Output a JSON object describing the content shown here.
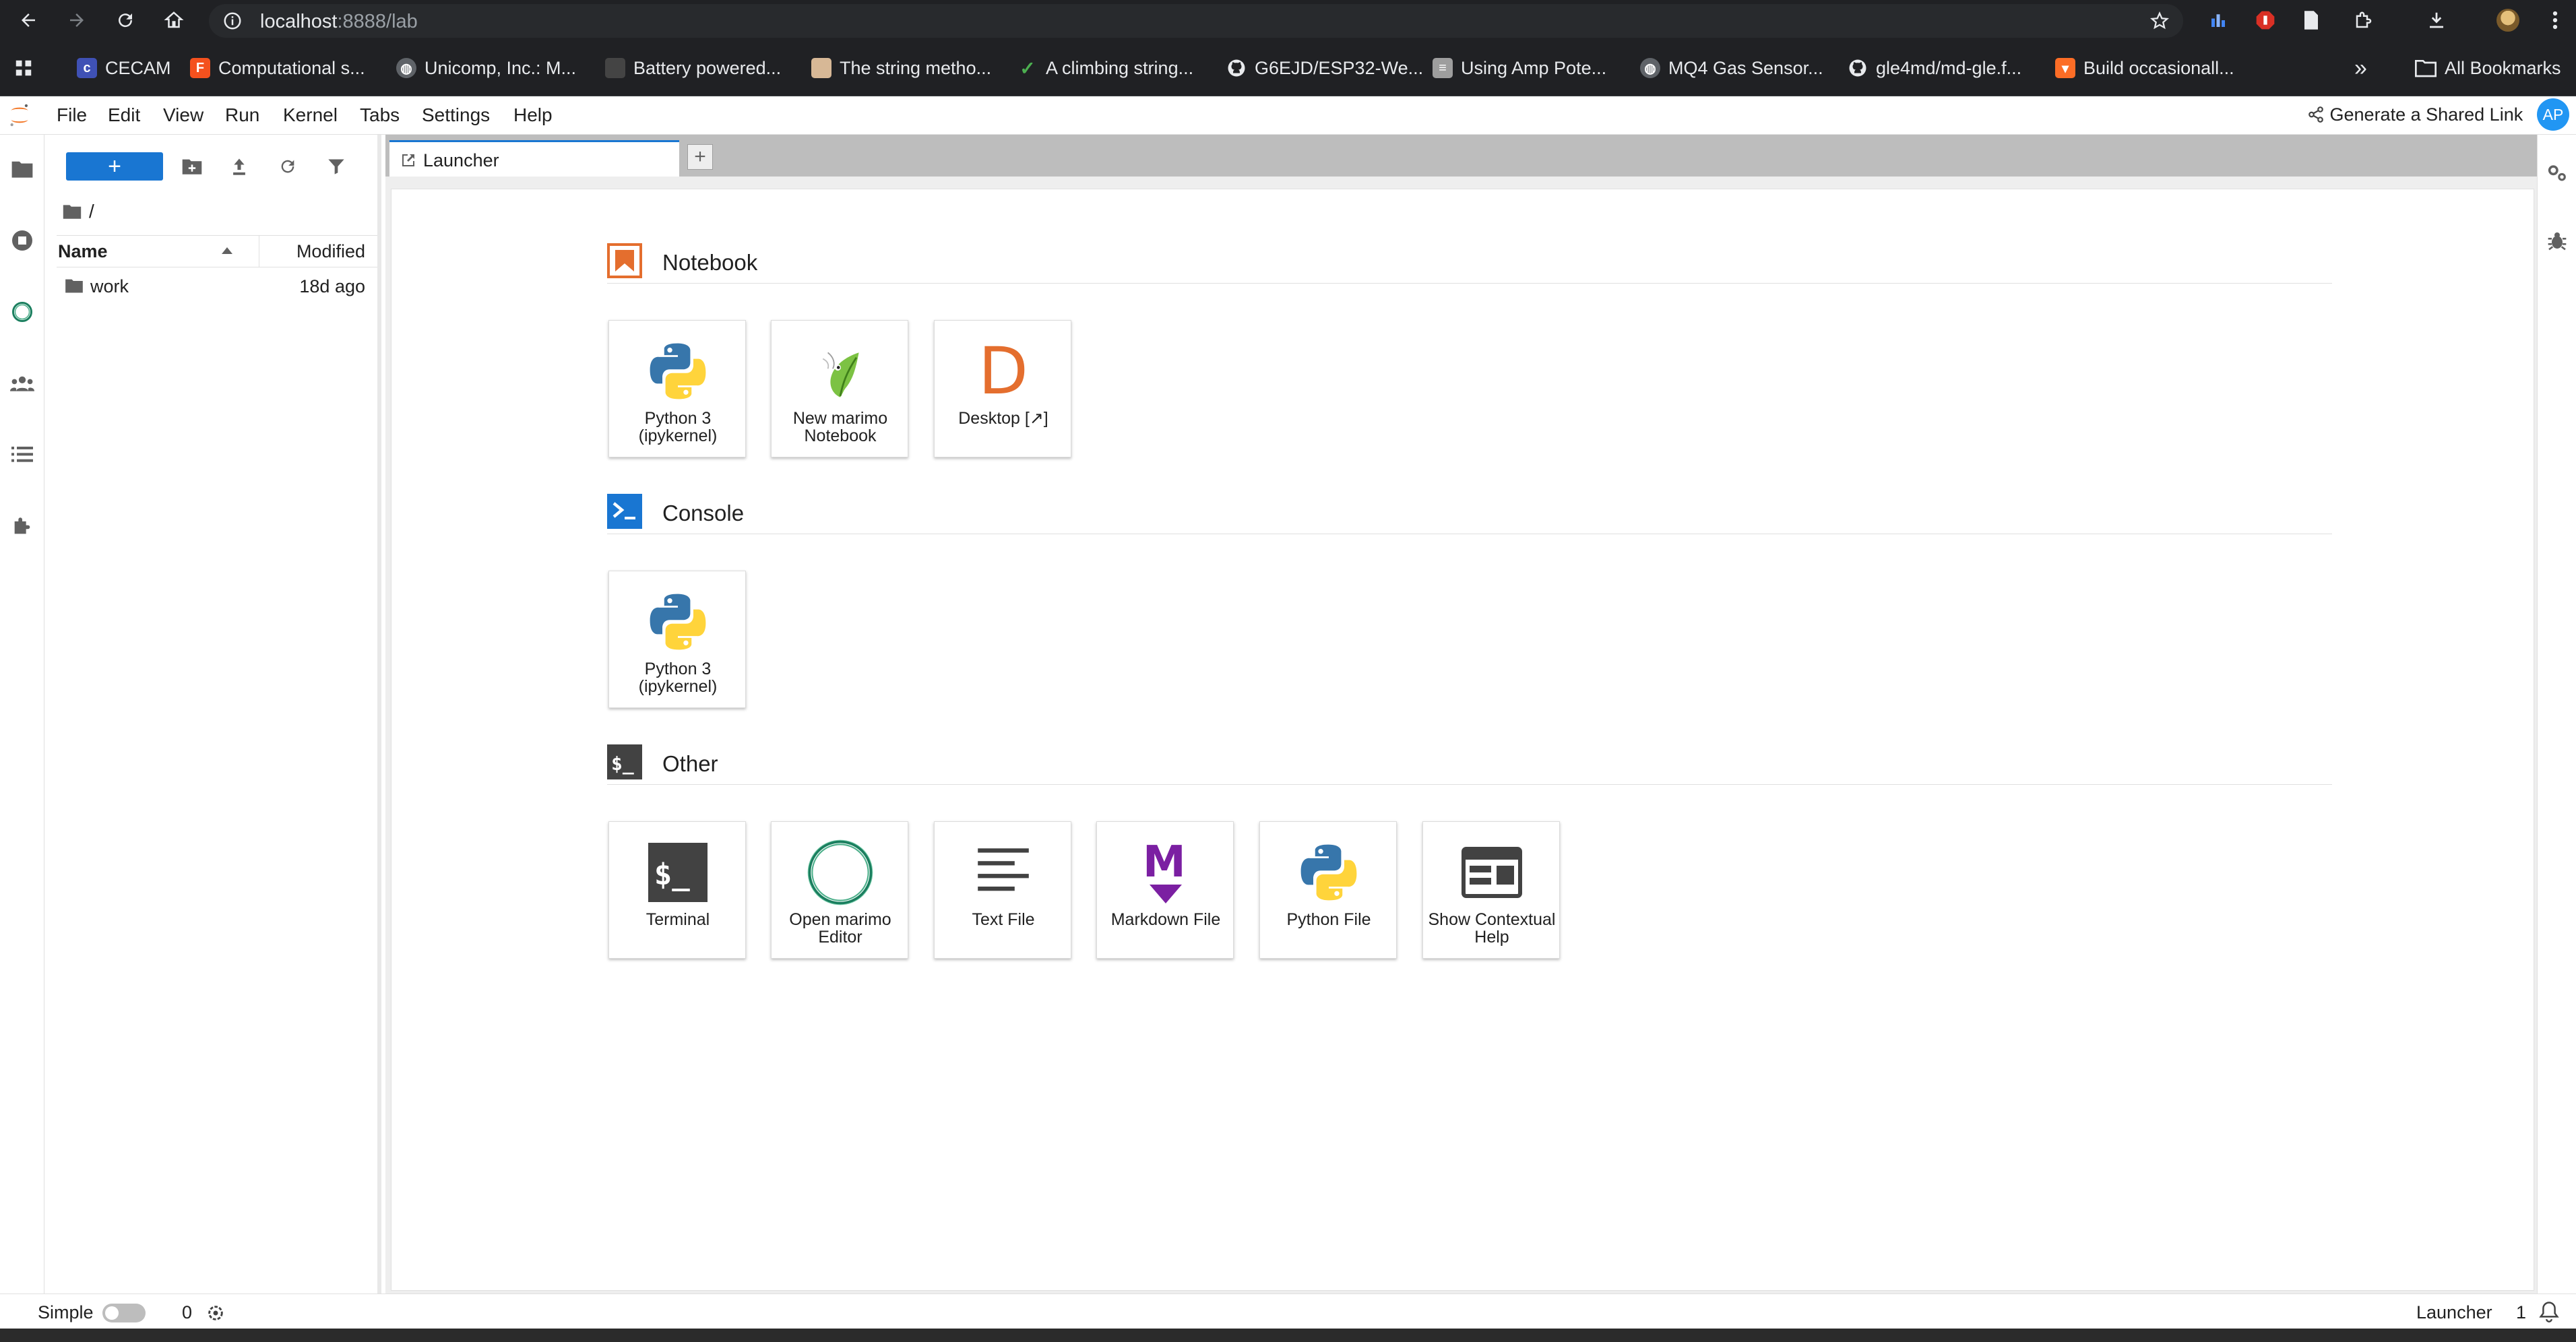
{
  "browser": {
    "url_host": "localhost",
    "url_rest": ":8888/lab",
    "bookmarks": [
      {
        "label": "CECAM",
        "icon": "cecam-icon",
        "color": "#3f51b5"
      },
      {
        "label": "Computational s...",
        "icon": "f-logo-icon",
        "color": "#f4511e"
      },
      {
        "label": "Unicomp, Inc.: M...",
        "icon": "globe-icon",
        "color": "#5f6368"
      },
      {
        "label": "Battery powered...",
        "icon": "page-icon",
        "color": "#444444"
      },
      {
        "label": "The string metho...",
        "icon": "image-icon",
        "color": "#d7b896"
      },
      {
        "label": "A climbing string...",
        "icon": "check-icon",
        "color": "#4caf50"
      },
      {
        "label": "G6EJD/ESP32-We...",
        "icon": "github-icon",
        "color": "#ffffff"
      },
      {
        "label": "Using Amp Pote...",
        "icon": "doc-icon",
        "color": "#9e9e9e"
      },
      {
        "label": "MQ4 Gas Sensor...",
        "icon": "globe-icon",
        "color": "#5f6368"
      },
      {
        "label": "gle4md/md-gle.f...",
        "icon": "github-icon",
        "color": "#ffffff"
      },
      {
        "label": "Build occasionall...",
        "icon": "gitlab-icon",
        "color": "#fc6d26"
      }
    ],
    "more_bookmarks": "»",
    "all_bookmarks_label": "All Bookmarks"
  },
  "menubar": {
    "items": [
      "File",
      "Edit",
      "View",
      "Run",
      "Kernel",
      "Tabs",
      "Settings",
      "Help"
    ],
    "share_label": "Generate a Shared Link",
    "user_initials": "AP"
  },
  "file_browser": {
    "new_button_label": "+",
    "breadcrumb": "/",
    "columns": {
      "name": "Name",
      "modified": "Modified"
    },
    "rows": [
      {
        "name": "work",
        "modified": "18d ago"
      }
    ]
  },
  "tabs": {
    "launcher_label": "Launcher",
    "add_label": "+"
  },
  "launcher": {
    "sections": [
      {
        "title": "Notebook",
        "items": [
          {
            "label": "Python 3 (ipykernel)",
            "icon": "python-icon"
          },
          {
            "label": "New marimo Notebook",
            "icon": "marimo-leaf-icon"
          },
          {
            "label": "Desktop [↗]",
            "icon": "desktop-d-icon"
          }
        ]
      },
      {
        "title": "Console",
        "items": [
          {
            "label": "Python 3 (ipykernel)",
            "icon": "python-icon"
          }
        ]
      },
      {
        "title": "Other",
        "items": [
          {
            "label": "Terminal",
            "icon": "terminal-icon"
          },
          {
            "label": "Open marimo Editor",
            "icon": "marimo-ring-icon"
          },
          {
            "label": "Text File",
            "icon": "text-file-icon"
          },
          {
            "label": "Markdown File",
            "icon": "markdown-icon"
          },
          {
            "label": "Python File",
            "icon": "python-icon"
          },
          {
            "label": "Show Contextual Help",
            "icon": "contextual-help-icon"
          }
        ]
      }
    ]
  },
  "status_bar": {
    "mode_label": "Simple",
    "kernel_count": "0",
    "right_label": "Launcher",
    "right_count": "1"
  },
  "colors": {
    "accent": "#1976d2",
    "notebook_orange": "#e46e2e",
    "console_blue": "#1976d2",
    "markdown_purple": "#7b1fa2"
  }
}
